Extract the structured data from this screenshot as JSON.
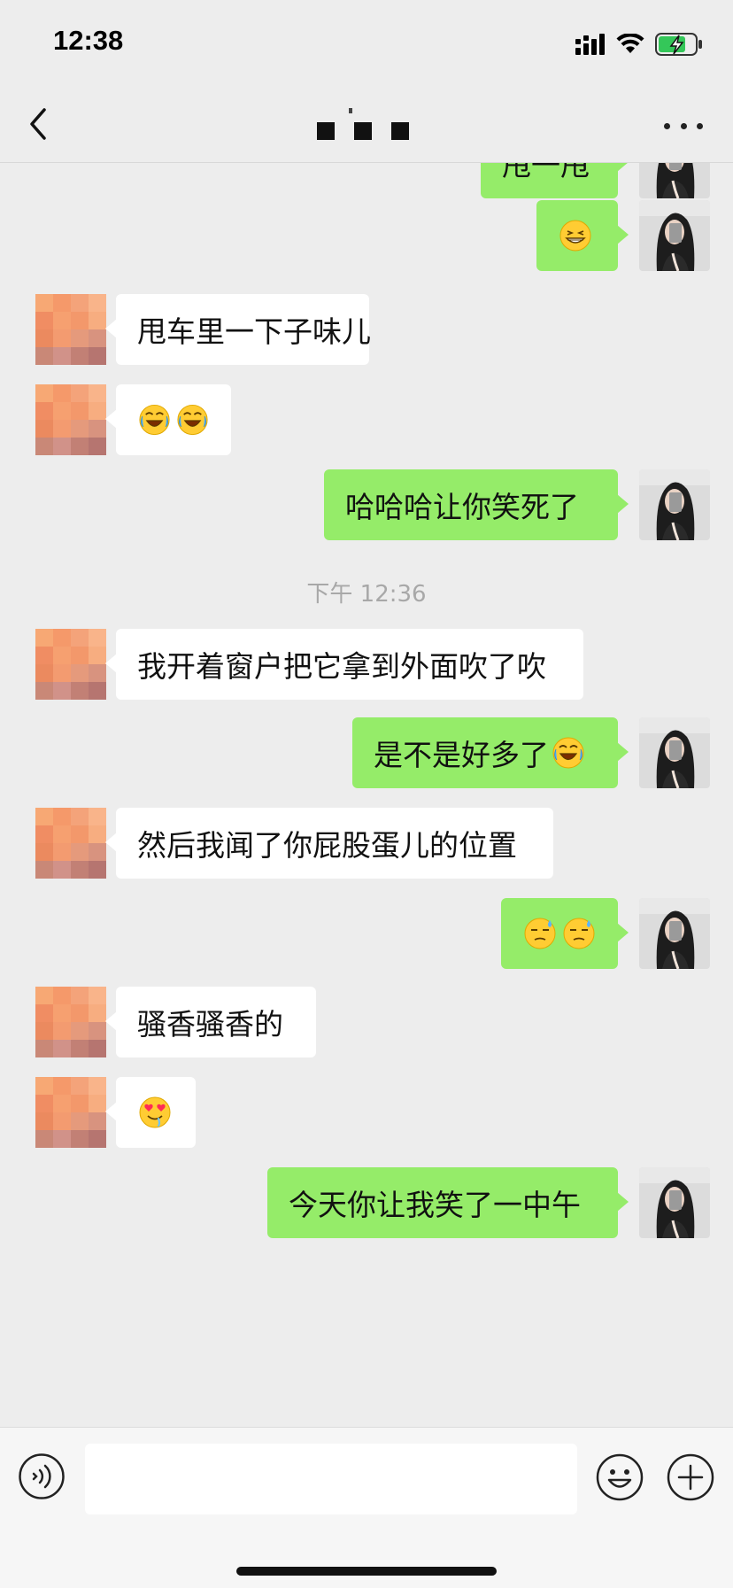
{
  "status_bar": {
    "time": "12:38",
    "icons": [
      "signal-icon",
      "wifi-icon",
      "battery-charging-icon"
    ]
  },
  "nav": {
    "back_icon": "chevron-left-icon",
    "title": "",
    "more_icon": "more-icon"
  },
  "colors": {
    "self_bubble": "#95ec69",
    "other_bubble": "#ffffff",
    "background": "#ededed"
  },
  "messages": [
    {
      "from": "self",
      "text": "甩一甩",
      "emojis": []
    },
    {
      "from": "self",
      "text": "",
      "emojis": [
        "grinning-squint-emoji"
      ]
    },
    {
      "from": "other",
      "text": "甩车里一下子味儿",
      "emojis": []
    },
    {
      "from": "other",
      "text": "",
      "emojis": [
        "rolling-laughing-emoji",
        "rolling-laughing-emoji"
      ]
    },
    {
      "from": "self",
      "text": "哈哈哈让你笑死了",
      "emojis": []
    },
    {
      "timestamp": "下午 12:36"
    },
    {
      "from": "other",
      "text": "我开着窗户把它拿到外面吹了吹",
      "emojis": []
    },
    {
      "from": "self",
      "text": "是不是好多了",
      "emojis": [
        "rolling-laughing-emoji"
      ]
    },
    {
      "from": "other",
      "text": "然后我闻了你屁股蛋儿的位置",
      "emojis": []
    },
    {
      "from": "self",
      "text": "",
      "emojis": [
        "sweat-emoji",
        "sweat-emoji"
      ]
    },
    {
      "from": "other",
      "text": "骚香骚香的",
      "emojis": []
    },
    {
      "from": "other",
      "text": "",
      "emojis": [
        "heart-eyes-drool-emoji"
      ]
    },
    {
      "from": "self",
      "text": "今天你让我笑了一中午",
      "emojis": []
    }
  ],
  "input_bar": {
    "voice_icon": "voice-icon",
    "input_value": "",
    "emoji_icon": "emoji-icon",
    "plus_icon": "plus-icon"
  }
}
